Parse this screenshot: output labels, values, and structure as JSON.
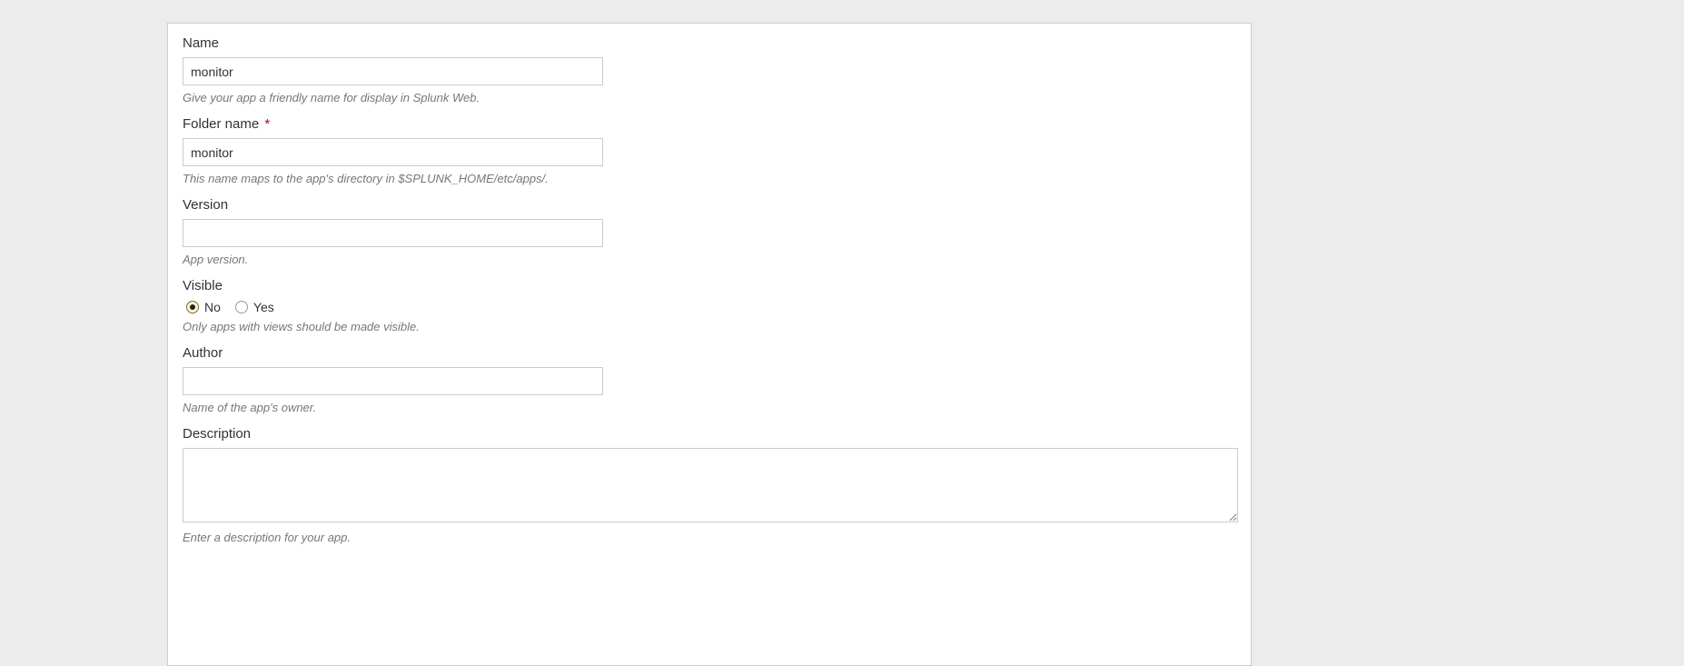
{
  "fields": {
    "name": {
      "label": "Name",
      "value": "monitor",
      "help": "Give your app a friendly name for display in Splunk Web."
    },
    "folder": {
      "label": "Folder name",
      "required": "*",
      "value": "monitor",
      "help": "This name maps to the app's directory in $SPLUNK_HOME/etc/apps/."
    },
    "version": {
      "label": "Version",
      "value": "",
      "help": "App version."
    },
    "visible": {
      "label": "Visible",
      "option_no": "No",
      "option_yes": "Yes",
      "help": "Only apps with views should be made visible."
    },
    "author": {
      "label": "Author",
      "value": "",
      "help": "Name of the app's owner."
    },
    "description": {
      "label": "Description",
      "value": "",
      "help": "Enter a description for your app."
    }
  }
}
